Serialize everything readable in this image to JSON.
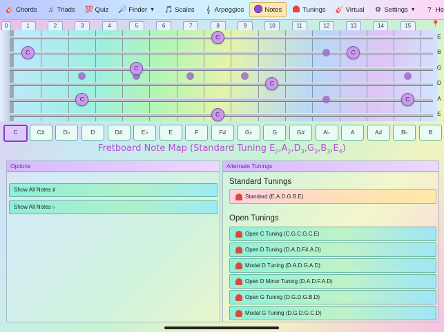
{
  "nav": {
    "items": [
      {
        "label": "Chords",
        "icon": "guitar-icon",
        "glyph": "🎸"
      },
      {
        "label": "Triads",
        "icon": "notes-icon",
        "glyph": "♫"
      },
      {
        "label": "Quiz",
        "icon": "score-icon",
        "glyph": "💯"
      },
      {
        "label": "Finder",
        "icon": "search-icon",
        "glyph": "🔎",
        "dropdown": true
      },
      {
        "label": "Scales",
        "icon": "music-note-icon",
        "glyph": "🎵"
      },
      {
        "label": "Arpeggios",
        "icon": "clef-icon",
        "glyph": "𝄞"
      },
      {
        "label": "Notes",
        "icon": "notes-dot-icon",
        "active": true
      },
      {
        "label": "Tunings",
        "icon": "tuning-icon"
      },
      {
        "label": "Virtual",
        "icon": "virtual-guitar-icon",
        "glyph": "🎸"
      },
      {
        "label": "Settings",
        "icon": "gear-icon",
        "glyph": "⚙",
        "dropdown": true
      },
      {
        "label": "Help",
        "icon": "help-icon",
        "glyph": "?"
      }
    ]
  },
  "frets": [
    "0",
    "1",
    "2",
    "3",
    "4",
    "5",
    "6",
    "7",
    "8",
    "9",
    "10",
    "11",
    "12",
    "13",
    "14",
    "15"
  ],
  "strings": [
    "E",
    "B",
    "G",
    "D",
    "A",
    "E"
  ],
  "markers": [
    {
      "string": 0,
      "fret": 8,
      "label": "C"
    },
    {
      "string": 1,
      "fret": 1,
      "label": "C"
    },
    {
      "string": 1,
      "fret": 13,
      "label": "C"
    },
    {
      "string": 2,
      "fret": 5,
      "label": "C"
    },
    {
      "string": 3,
      "fret": 10,
      "label": "C"
    },
    {
      "string": 4,
      "fret": 3,
      "label": "C"
    },
    {
      "string": 4,
      "fret": 15,
      "label": "C"
    },
    {
      "string": 5,
      "fret": 8,
      "label": "C"
    }
  ],
  "note_buttons": [
    "C",
    "C#",
    "D♭",
    "D",
    "D#",
    "E♭",
    "E",
    "F",
    "F#",
    "G♭",
    "G",
    "G#",
    "A♭",
    "A",
    "A#",
    "B♭",
    "B"
  ],
  "selected_note": "C",
  "map_title": {
    "prefix": "Fretboard Note Map (Standard Tuning E",
    "s1": "2",
    "a": ",A",
    "s2": "2",
    "d": ",D",
    "s3": "3",
    "g": ",G",
    "s4": "3",
    "b": ",B",
    "s5": "3",
    "e": ",E",
    "s6": "4",
    "suffix": ")"
  },
  "options": {
    "header": "Options",
    "buttons": [
      "Show All Notes ♯",
      "Show All Notes ♭"
    ]
  },
  "alternate": {
    "header": "Alternate Tunings",
    "standard_title": "Standard Tunings",
    "standard": [
      "Standard (E.A.D.G.B.E)"
    ],
    "open_title": "Open Tunings",
    "open": [
      "Open C Tuning (C.G.C.G.C.E)",
      "Open D Tuning (D.A.D.F#.A.D)",
      "Modal D Tuning (D.A.D.G.A.D)",
      "Open D Minor Tuning (D.A.D.F.A.D)",
      "Open G Tuning (D.G.D.G.B.D)",
      "Modal G Tuning (D.G.D.G.C.D)"
    ]
  },
  "colors": {
    "accent": "#b34fd4",
    "active_note": "#7a40c8"
  }
}
